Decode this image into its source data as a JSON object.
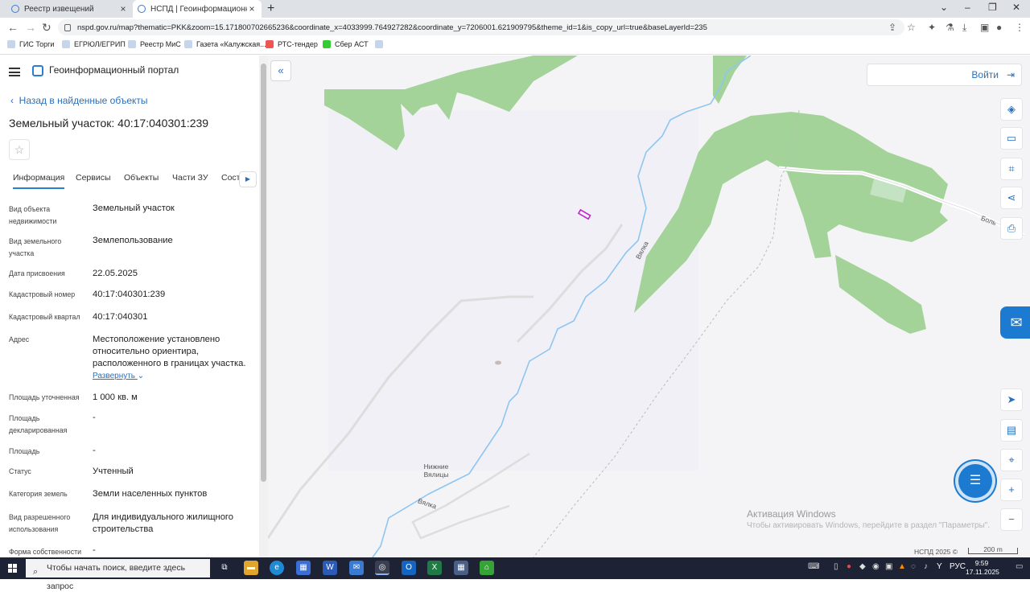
{
  "browser": {
    "tabs": [
      {
        "title": "Реестр извещений"
      },
      {
        "title": "НСПД | Геоинформационный п"
      }
    ],
    "url": "nspd.gov.ru/map?thematic=PKK&zoom=15.171800702665236&coordinate_x=4033999.764927282&coordinate_y=7206001.621909795&theme_id=1&is_copy_url=true&baseLayerId=235",
    "bookmarks": [
      "ГИС Торги",
      "ЕГРЮЛ/ЕГРИП",
      "Реестр МиС",
      "Газета «Калужская...",
      "РТС-тендер",
      "Сбер АСТ"
    ]
  },
  "panel": {
    "portal_name": "Геоинформационный портал",
    "back_link": "Назад в найденные объекты",
    "title": "Земельный участок: 40:17:040301:239",
    "tabs": [
      "Информация",
      "Сервисы",
      "Объекты",
      "Части ЗУ",
      "Соста"
    ],
    "expand_link": "Развернуть",
    "fields": [
      {
        "label": "Вид объекта недвижимости",
        "value": "Земельный участок"
      },
      {
        "label": "Вид земельного участка",
        "value": "Землепользование"
      },
      {
        "label": "Дата присвоения",
        "value": "22.05.2025"
      },
      {
        "label": "Кадастровый номер",
        "value": "40:17:040301:239"
      },
      {
        "label": "Кадастровый квартал",
        "value": "40:17:040301"
      },
      {
        "label": "Адрес",
        "value": "Местоположение установлено относительно ориентира, расположенного в границах участка."
      },
      {
        "label": "Площадь уточненная",
        "value": "1 000 кв. м"
      },
      {
        "label": "Площадь декларированная",
        "value": "-"
      },
      {
        "label": "Площадь",
        "value": "-"
      },
      {
        "label": "Статус",
        "value": "Учтенный"
      },
      {
        "label": "Категория земель",
        "value": "Земли населенных пунктов"
      },
      {
        "label": "Вид разрешенного использования",
        "value": "Для индивидуального жилищного строительства"
      },
      {
        "label": "Форма собственности",
        "value": "-"
      }
    ]
  },
  "map": {
    "login_label": "Войти",
    "labels": {
      "village": "Нижние Вялицы",
      "river1": "Вялка",
      "river2": "Вялка",
      "road": "Боль"
    },
    "windows_watermark_title": "Активация Windows",
    "windows_watermark_text": "Чтобы активировать Windows, перейдите в раздел \"Параметры\".",
    "copyright": "НСПД 2025 ©",
    "scale": "200 m",
    "colors": {
      "forest": "#a4d39a",
      "water": "#8ec6f0",
      "parcel": "#c128c9",
      "background": "#f4f4f7"
    }
  },
  "taskbar": {
    "search_placeholder": "Чтобы начать поиск, введите здесь запрос",
    "lang": "РУС",
    "time": "9:59",
    "date": "17.11.2025"
  }
}
